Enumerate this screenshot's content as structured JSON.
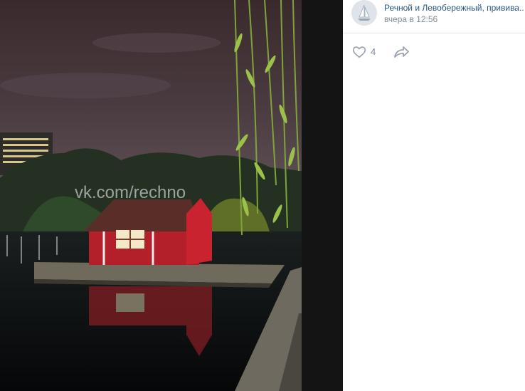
{
  "photo": {
    "watermark": "vk.com/rechno"
  },
  "post": {
    "author": "Речной и Левобережный, привива...",
    "time": "вчера в 12:56",
    "likes": "4"
  },
  "icons": {
    "like": "heart-icon",
    "share": "share-arrow-icon"
  }
}
